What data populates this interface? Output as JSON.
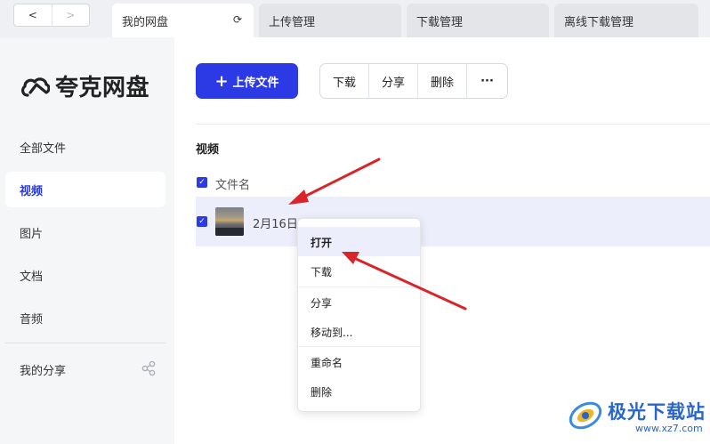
{
  "nav": {
    "back": "<",
    "forward": ">"
  },
  "tabs": [
    {
      "label": "我的网盘",
      "refresh": "⟳"
    },
    {
      "label": "上传管理"
    },
    {
      "label": "下载管理"
    },
    {
      "label": "离线下载管理"
    }
  ],
  "sidebar": {
    "logo_text": "夸克网盘",
    "items": [
      {
        "label": "全部文件"
      },
      {
        "label": "视频"
      },
      {
        "label": "图片"
      },
      {
        "label": "文档"
      },
      {
        "label": "音频"
      },
      {
        "label": "我的分享"
      }
    ]
  },
  "toolbar": {
    "upload_plus": "+",
    "upload_label": "上传文件",
    "download_label": "下载",
    "share_label": "分享",
    "delete_label": "删除",
    "more_label": "···"
  },
  "content": {
    "section_title": "视频",
    "column_header": "文件名",
    "files": [
      {
        "name": "2月16日"
      }
    ]
  },
  "context_menu": {
    "items": [
      {
        "label": "打开"
      },
      {
        "label": "下载"
      },
      {
        "label": "分享"
      },
      {
        "label": "移动到..."
      },
      {
        "label": "重命名"
      },
      {
        "label": "删除"
      }
    ]
  },
  "watermark": {
    "title": "极光下载站",
    "url": "www.xz7.com"
  },
  "colors": {
    "accent": "#2c3ae6",
    "arrow": "#d9242a",
    "selected_row": "#eceefb"
  }
}
